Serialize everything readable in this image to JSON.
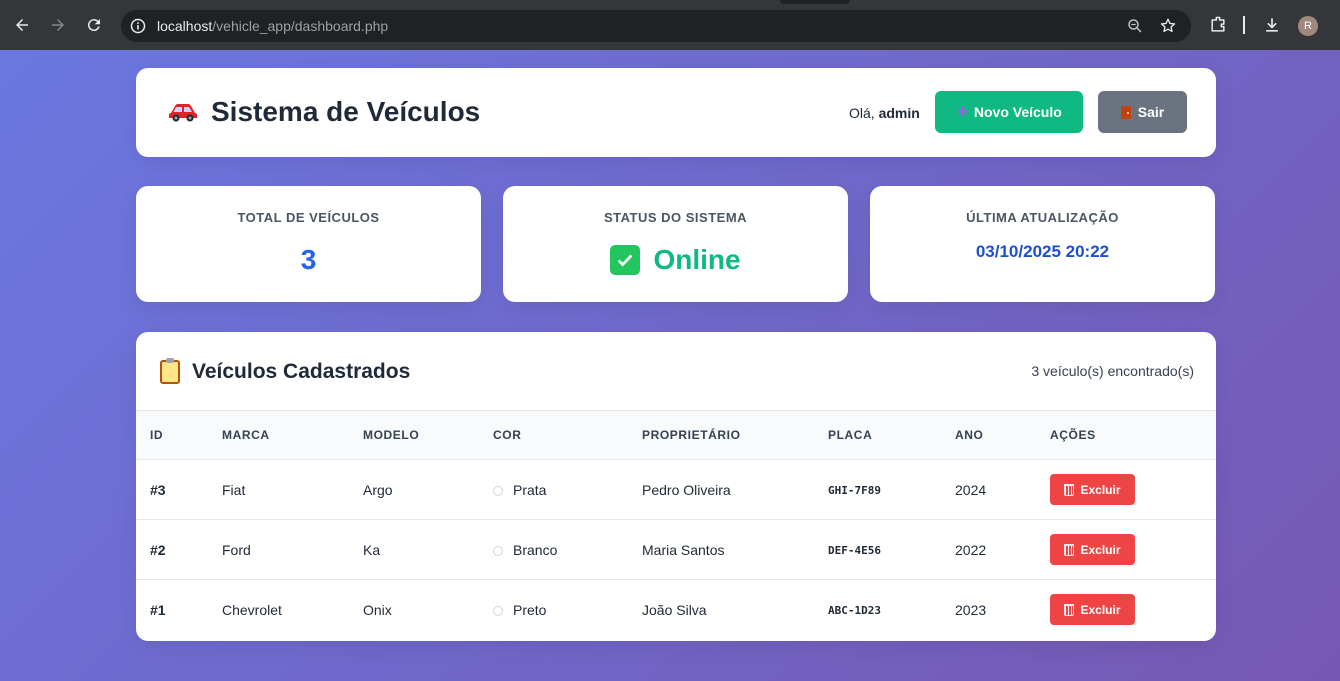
{
  "browser": {
    "url_host": "localhost",
    "url_path": "/vehicle_app/dashboard.php",
    "profile_initial": "R"
  },
  "header": {
    "title": "Sistema de Veículos",
    "greeting_prefix": "Olá,",
    "username": "admin",
    "new_vehicle_label": "Novo Veículo",
    "logout_label": "Sair"
  },
  "stats": {
    "total_label": "TOTAL DE VEÍCULOS",
    "total_value": "3",
    "status_label": "STATUS DO SISTEMA",
    "status_value": "Online",
    "updated_label": "ÚLTIMA ATUALIZAÇÃO",
    "updated_value": "03/10/2025 20:22"
  },
  "table": {
    "title": "Veículos Cadastrados",
    "count_text": "3 veículo(s) encontrado(s)",
    "headers": {
      "id": "ID",
      "marca": "MARCA",
      "modelo": "MODELO",
      "cor": "COR",
      "proprietario": "PROPRIETÁRIO",
      "placa": "PLACA",
      "ano": "ANO",
      "acoes": "AÇÕES"
    },
    "delete_label": "Excluir",
    "rows": [
      {
        "id": "#3",
        "marca": "Fiat",
        "modelo": "Argo",
        "cor": "Prata",
        "proprietario": "Pedro Oliveira",
        "placa": "GHI-7F89",
        "ano": "2024"
      },
      {
        "id": "#2",
        "marca": "Ford",
        "modelo": "Ka",
        "cor": "Branco",
        "proprietario": "Maria Santos",
        "placa": "DEF-4E56",
        "ano": "2022"
      },
      {
        "id": "#1",
        "marca": "Chevrolet",
        "modelo": "Onix",
        "cor": "Preto",
        "proprietario": "João Silva",
        "placa": "ABC-1D23",
        "ano": "2023"
      }
    ]
  },
  "colors": {
    "accent_green": "#10b981",
    "accent_blue": "#2563eb",
    "danger": "#ef4444",
    "muted_button": "#6b7280",
    "gradient_start": "#6a78e0",
    "gradient_end": "#7658b4"
  }
}
